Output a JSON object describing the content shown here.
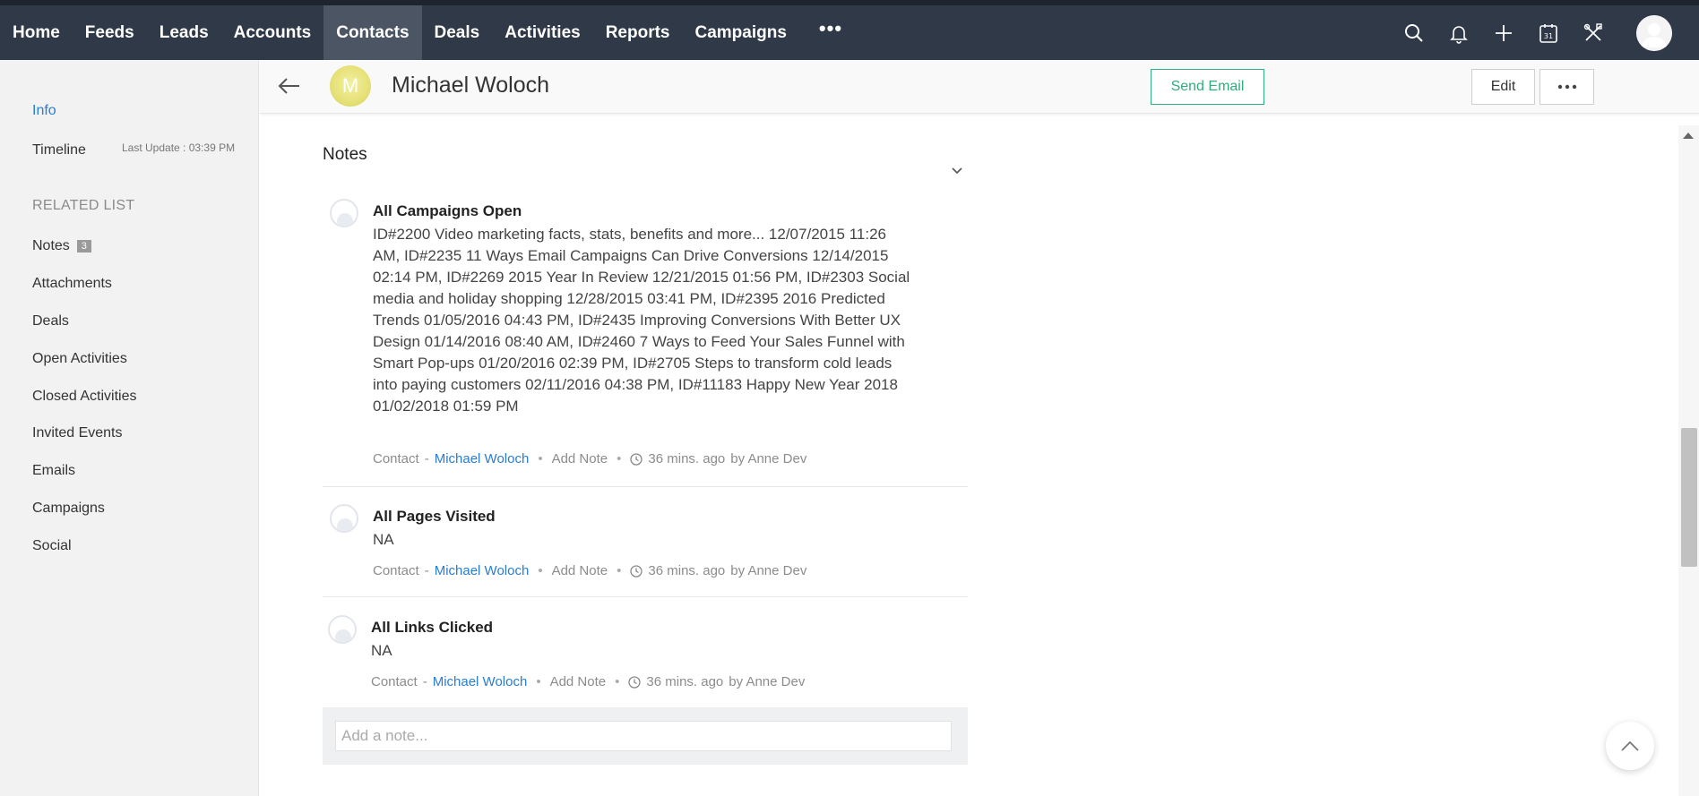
{
  "topnav": {
    "items": [
      {
        "label": "Home"
      },
      {
        "label": "Feeds"
      },
      {
        "label": "Leads"
      },
      {
        "label": "Accounts"
      },
      {
        "label": "Contacts",
        "active": true
      },
      {
        "label": "Deals"
      },
      {
        "label": "Activities"
      },
      {
        "label": "Reports"
      },
      {
        "label": "Campaigns"
      }
    ],
    "more_label": "•••",
    "icons": [
      "search-icon",
      "bell-icon",
      "plus-icon",
      "calendar-icon",
      "tools-icon",
      "user-avatar"
    ],
    "calendar_day": "31"
  },
  "sidebar": {
    "info_label": "Info",
    "timeline_label": "Timeline",
    "last_update": "Last Update : 03:39 PM",
    "related_heading": "RELATED LIST",
    "related": [
      {
        "label": "Notes",
        "badge": "3"
      },
      {
        "label": "Attachments"
      },
      {
        "label": "Deals"
      },
      {
        "label": "Open Activities"
      },
      {
        "label": "Closed Activities"
      },
      {
        "label": "Invited Events"
      },
      {
        "label": "Emails"
      },
      {
        "label": "Campaigns"
      },
      {
        "label": "Social"
      }
    ]
  },
  "record": {
    "avatar_initial": "M",
    "name": "Michael Woloch",
    "send_email_label": "Send Email",
    "edit_label": "Edit"
  },
  "notes": {
    "title": "Notes",
    "items": [
      {
        "title": "All Campaigns Open",
        "body": "ID#2200 Video marketing facts, stats, benefits and more... 12/07/2015 11:26 AM, ID#2235 11 Ways Email Campaigns Can Drive Conversions 12/14/2015 02:14 PM, ID#2269 2015 Year In Review 12/21/2015 01:56 PM, ID#2303 Social media and holiday shopping 12/28/2015 03:41 PM, ID#2395 2016 Predicted Trends 01/05/2016 04:43 PM, ID#2435 Improving Conversions With Better UX Design 01/14/2016 08:40 AM, ID#2460 7 Ways to Feed Your Sales Funnel with Smart Pop-ups 01/20/2016 02:39 PM, ID#2705 Steps to transform cold leads into paying customers 02/11/2016 04:38 PM, ID#11183 Happy New Year 2018 01/02/2018 01:59 PM",
        "meta_contact": "Contact",
        "meta_sep": "-",
        "meta_name": "Michael Woloch",
        "meta_add": "Add Note",
        "meta_time": "36 mins. ago",
        "meta_by": "by Anne Dev"
      },
      {
        "title": "All Pages Visited",
        "body": "NA",
        "meta_contact": "Contact",
        "meta_sep": "-",
        "meta_name": "Michael Woloch",
        "meta_add": "Add Note",
        "meta_time": "36 mins. ago",
        "meta_by": "by Anne Dev"
      },
      {
        "title": "All Links Clicked",
        "body": "NA",
        "meta_contact": "Contact",
        "meta_sep": "-",
        "meta_name": "Michael Woloch",
        "meta_add": "Add Note",
        "meta_time": "36 mins. ago",
        "meta_by": "by Anne Dev"
      }
    ],
    "add_placeholder": "Add a note..."
  },
  "colors": {
    "topbar": "#2f3947",
    "active_tab": "#4b5563",
    "link": "#2a7dd2",
    "send_email": "#2fae7e",
    "avatar": "#e7e27a"
  }
}
